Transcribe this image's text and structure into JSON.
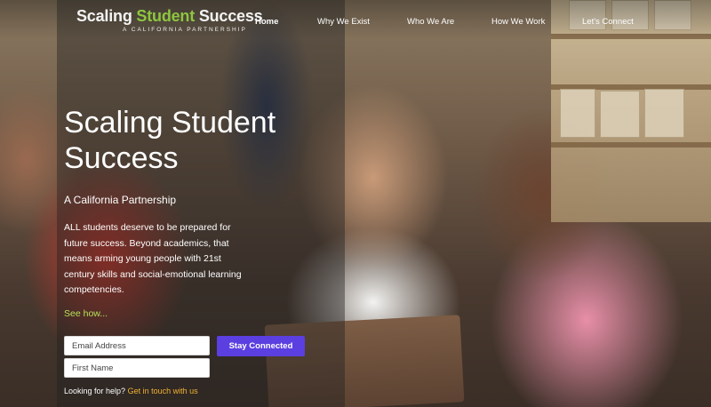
{
  "header": {
    "logo_part1": "Scaling ",
    "logo_part2": "Student",
    "logo_part3": " Success",
    "logo_subtitle": "A CALIFORNIA PARTNERSHIP",
    "nav": [
      {
        "label": "Home",
        "active": true
      },
      {
        "label": "Why We Exist",
        "active": false
      },
      {
        "label": "Who We Are",
        "active": false
      },
      {
        "label": "How We Work",
        "active": false
      },
      {
        "label": "Let's Connect",
        "active": false
      }
    ]
  },
  "hero": {
    "title": "Scaling Student Success",
    "subtitle": "A California Partnership",
    "body": "ALL students deserve to be prepared for future success. Beyond academics, that means arming young people with 21st century skills and social-emotional learning competencies.",
    "see_how": "See how..."
  },
  "form": {
    "email_placeholder": "Email Address",
    "name_placeholder": "First Name",
    "submit_label": "Stay Connected",
    "help_text": "Looking for help?",
    "help_link": "Get in touch with us"
  },
  "colors": {
    "accent_green": "#8dc63f",
    "link_green": "#b6e05a",
    "button_purple": "#5b3fe0",
    "help_link_orange": "#f2b134"
  }
}
